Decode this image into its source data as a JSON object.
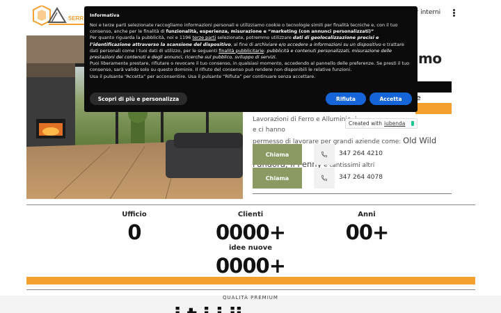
{
  "header": {
    "logo_text": "SERRA",
    "nav_item": "er interni",
    "menu_icon": "kebab-menu-icon"
  },
  "hero": {
    "title": "amo",
    "highlight_tail": "e",
    "description": "Lavorazioni di Ferro e Alluminio, i",
    "description_2": "e ci hanno",
    "description_line2": "permesso di lavorare per grandi aziende come:",
    "brands_1": "Old Wild West,",
    "brands_2": "Pandora, Il Penny",
    "brands_tail": "e tantissimi altri"
  },
  "contacts": [
    {
      "button": "Chiama",
      "phone": "347 264 4210"
    },
    {
      "button": "Chiama",
      "phone": "347 264 4078"
    }
  ],
  "stats": [
    {
      "label": "Ufficio",
      "value": "0"
    },
    {
      "label": "Clienti",
      "value": "0000+"
    },
    {
      "label": "Anni",
      "value": "00+"
    },
    {
      "label": "idee nuove",
      "value": "0000+"
    }
  ],
  "section": {
    "eyebrow": "QUALITÀ PREMIUM",
    "heading_partial": "i   t i     i  ii"
  },
  "cookie": {
    "title": "Informativa",
    "text_1": "Noi e terze parti selezionate raccogliamo informazioni personali e utilizziamo cookie o tecnologie simili per finalità tecniche e, con il tuo consenso, anche per le finalità di ",
    "text_1_bold": "funzionalità, esperienza, misurazione e “marketing (con annunci personalizzati)”",
    "text_2": "Per quanto riguarda la pubblicità, noi e 1196 ",
    "text_2_link": "terze parti",
    "text_2b": " selezionate, potremmo utilizzare ",
    "text_2_italic": "dati di geolocalizzazione precisi e l’identificazione attraverso la scansione del dispositivo",
    "text_2c": ", al fine di ",
    "text_2_italic2": "archiviare e/o accedere a informazioni su un dispositivo",
    "text_2d": " e trattare dati personali come i tuoi dati di utilizzo, per le seguenti ",
    "text_2_link2": "finalità pubblicitarie",
    "text_2e": ": ",
    "text_2_italic3": "pubblicità e contenuti personalizzati, misurazione delle prestazioni dei contenuti e degli annunci, ricerche sul pubblico, sviluppo di servizi.",
    "text_3": "Puoi liberamente prestare, rifiutare o revocare il tuo consenso, in qualsiasi momento, accedendo al pannello delle preferenze. Se presti il tuo consenso, sarà valido solo su questo dominio. Il rifiuto del consenso può rendere non disponibili le relative funzioni.",
    "text_4": "Usa il pulsante “Accetta” per acconsentire. Usa il pulsante “Rifiuta” per continuare senza accettare.",
    "btn_more": "Scopri di più e personalizza",
    "btn_reject": "Rifiuta",
    "btn_accept": "Accetta"
  },
  "iubenda": {
    "prefix": "Created with",
    "link": "iubenda"
  },
  "colors": {
    "accent_orange": "#f4a02e",
    "button_green": "#8b9a63",
    "cookie_blue": "#1565d8"
  }
}
